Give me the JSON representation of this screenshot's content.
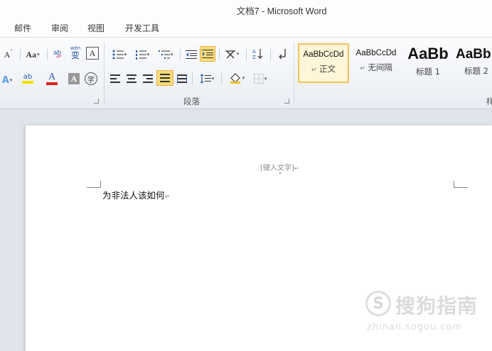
{
  "window": {
    "title": "文档7 - Microsoft Word"
  },
  "menu_tabs": [
    "邮件",
    "审阅",
    "视图",
    "开发工具"
  ],
  "ribbon": {
    "font_group": {
      "grow_font": "A",
      "change_case": "Aa",
      "phonetic": "wén",
      "phonetic_char": "变",
      "char_border": "A",
      "text_effect": "A",
      "highlight": "ab",
      "font_color": "A",
      "char_shading": "A",
      "enclose": "字"
    },
    "paragraph_group": {
      "label": "段落"
    },
    "styles_group": {
      "label": "样",
      "items": [
        {
          "preview": "AaBbCcDd",
          "name": "正文",
          "mark": "↵"
        },
        {
          "preview": "AaBbCcDd",
          "name": "无间隔",
          "mark": "↵"
        },
        {
          "preview": "AaBb",
          "name": "标题 1"
        },
        {
          "preview": "AaBb",
          "name": "标题 2"
        }
      ]
    },
    "colors": {
      "highlight": "#f5e000",
      "font_color": "#e02020",
      "active_border": "#f2c35b"
    }
  },
  "document": {
    "header_placeholder": "[键入文字]",
    "header_mark": "↵",
    "body_text": "为非法人该如何",
    "paragraph_mark": "↵"
  },
  "watermark": {
    "text": "搜狗指南",
    "url": "zhinan.sogou.com"
  }
}
